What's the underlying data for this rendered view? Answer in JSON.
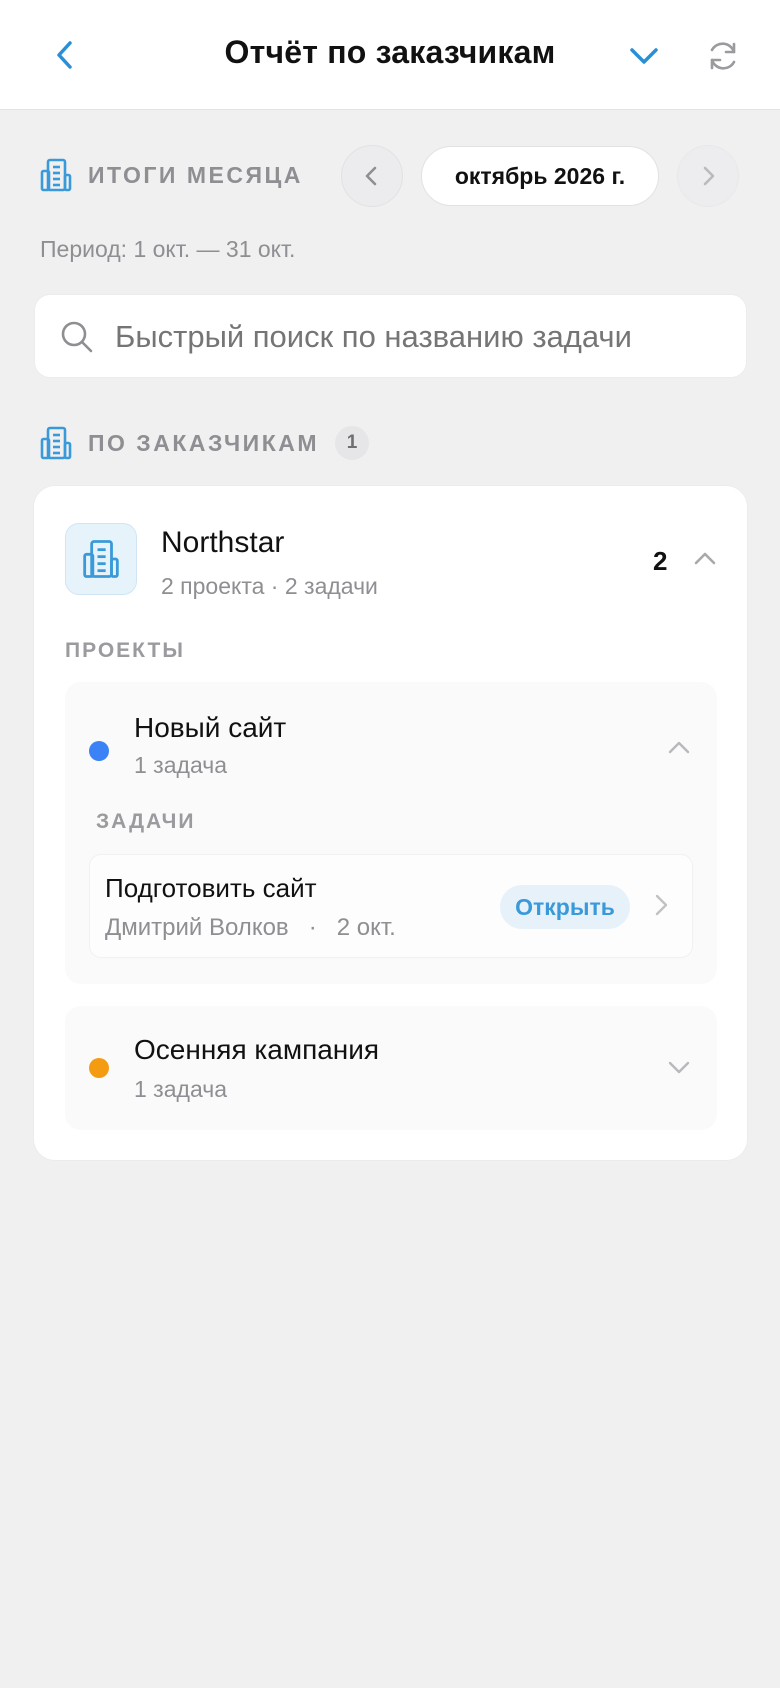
{
  "header": {
    "title": "Отчёт по заказчикам",
    "accent": "#2a8fd6"
  },
  "summary": {
    "label": "ИТОГИ МЕСЯЦА",
    "month": "октябрь 2026 г.",
    "period": "Период: 1 окт. — 31 окт."
  },
  "search": {
    "value": "",
    "placeholder": "Быстрый поиск по названию задачи"
  },
  "clients_section": {
    "label": "ПО ЗАКАЗЧИКАМ",
    "count": "1"
  },
  "client": {
    "name": "Northstar",
    "subtitle": "2 проекта · 2 задачи",
    "count": "2",
    "expanded": true,
    "projects_label": "ПРОЕКТЫ",
    "projects": [
      {
        "name": "Новый сайт",
        "count": "1 задача",
        "color": "#3b82f6",
        "expanded": true,
        "tasks_label": "ЗАДАЧИ",
        "tasks": [
          {
            "title": "Подготовить сайт",
            "assignee": "Дмитрий Волков",
            "separator": "·",
            "date": "2 окт.",
            "action": "Открыть"
          }
        ]
      },
      {
        "name": "Осенняя кампания",
        "count": "1 задача",
        "color": "#f39c12",
        "expanded": false
      }
    ]
  },
  "icons": {
    "back": "chevron-left-icon",
    "dropdown": "chevron-down-icon",
    "refresh": "refresh-icon",
    "section": "building-icon",
    "search": "search-icon"
  }
}
